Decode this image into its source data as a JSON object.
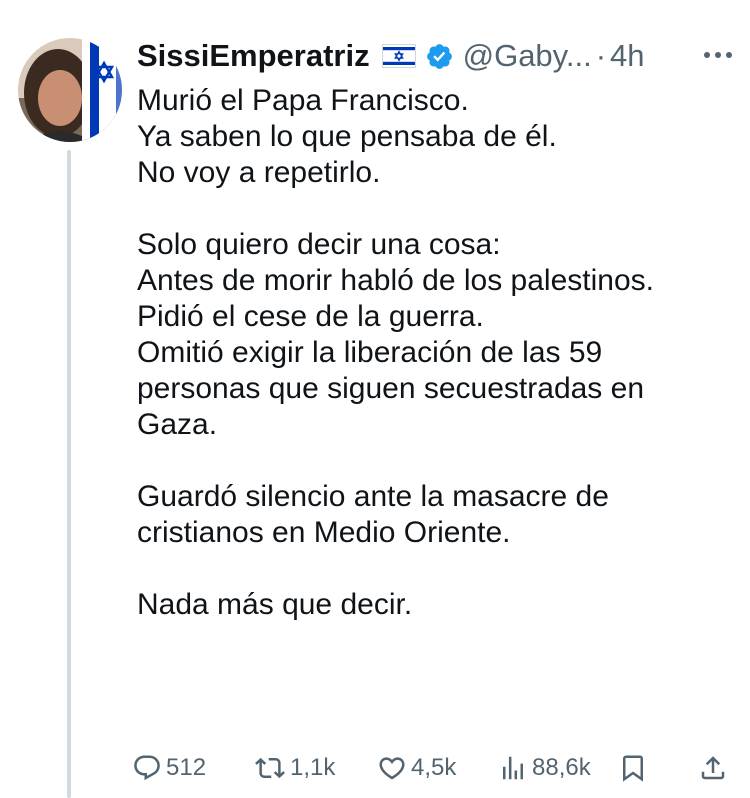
{
  "author": {
    "display_name": "SissiEmperatriz",
    "flag": "🇮🇱",
    "verified": true,
    "handle": "@Gaby...",
    "separator": "·",
    "timestamp": "4h"
  },
  "tweet": {
    "lines": [
      "Murió el Papa Francisco.",
      "Ya saben lo que pensaba de él.",
      "No voy a repetirlo.",
      "",
      "Solo quiero decir una cosa:",
      "Antes de morir habló de los palestinos.",
      "Pidió el cese de la guerra.",
      "Omitió exigir la liberación de las 59",
      "personas que siguen secuestradas en",
      "Gaza.",
      "",
      "Guardó silencio ante la masacre de",
      "cristianos en Medio Oriente.",
      "",
      "Nada más que decir."
    ]
  },
  "actions": {
    "replies": "512",
    "retweets": "1,1k",
    "likes": "4,5k",
    "views": "88,6k"
  },
  "colors": {
    "text": "#0f1419",
    "secondary": "#536471",
    "verified_badge": "#1d9bf0",
    "thread_line": "#cfd9de",
    "flag_blue": "#0038b8"
  },
  "icons": [
    "more-icon",
    "verified-badge-icon",
    "israel-flag-icon",
    "reply-icon",
    "retweet-icon",
    "like-icon",
    "views-icon",
    "bookmark-icon",
    "share-icon"
  ]
}
